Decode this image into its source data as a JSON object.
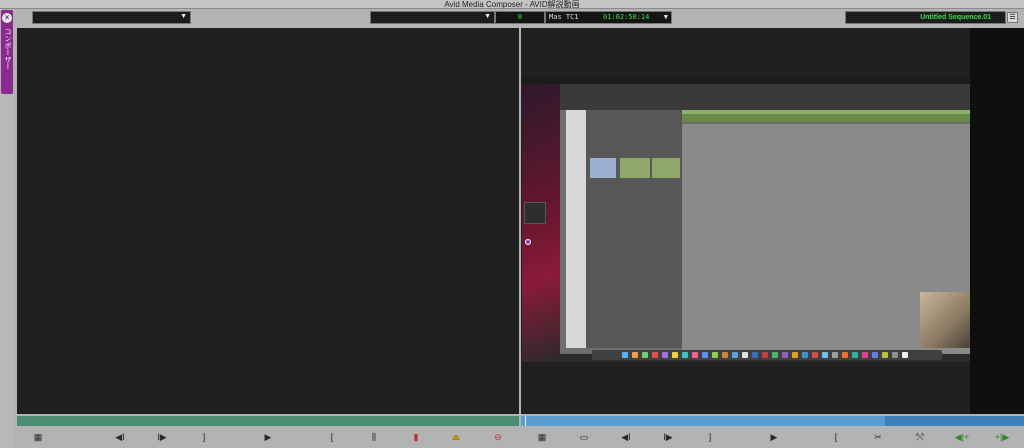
{
  "app": {
    "title": "Avid Media Composer - AVID解説動画",
    "side_tab_label": "コンポーザー",
    "close_glyph": "×"
  },
  "source_monitor": {
    "clip_menu": "",
    "menu_arrow": "▼",
    "scrub_color": "#4a8f72"
  },
  "record_monitor": {
    "tracks_menu": "",
    "counter": "0",
    "tc_label": "Mas  TC1",
    "timecode": "01:02:50:14",
    "sequence_name": "Untitled Sequence.01",
    "scrub_color": "#5a9bd0",
    "timecode_color": "#3adf4a"
  },
  "controls_left": {
    "clip_icon": "▦",
    "step_back": "◀I",
    "step_fwd": "I▶",
    "mark_out": "]",
    "play": "▶",
    "mark_in": "[",
    "mark_clip": "⫼",
    "splice": "▮",
    "overwrite": "⏏",
    "lift": "⊖"
  },
  "controls_right": {
    "clip_icon": "▦",
    "trim": "▭",
    "step_back": "◀I",
    "step_fwd": "I▶",
    "mark_out": "]",
    "play": "▶",
    "mark_in": "[",
    "cut": "✂",
    "sync": "⤲",
    "go_prev": "◀|+",
    "go_next": "+|▶"
  }
}
